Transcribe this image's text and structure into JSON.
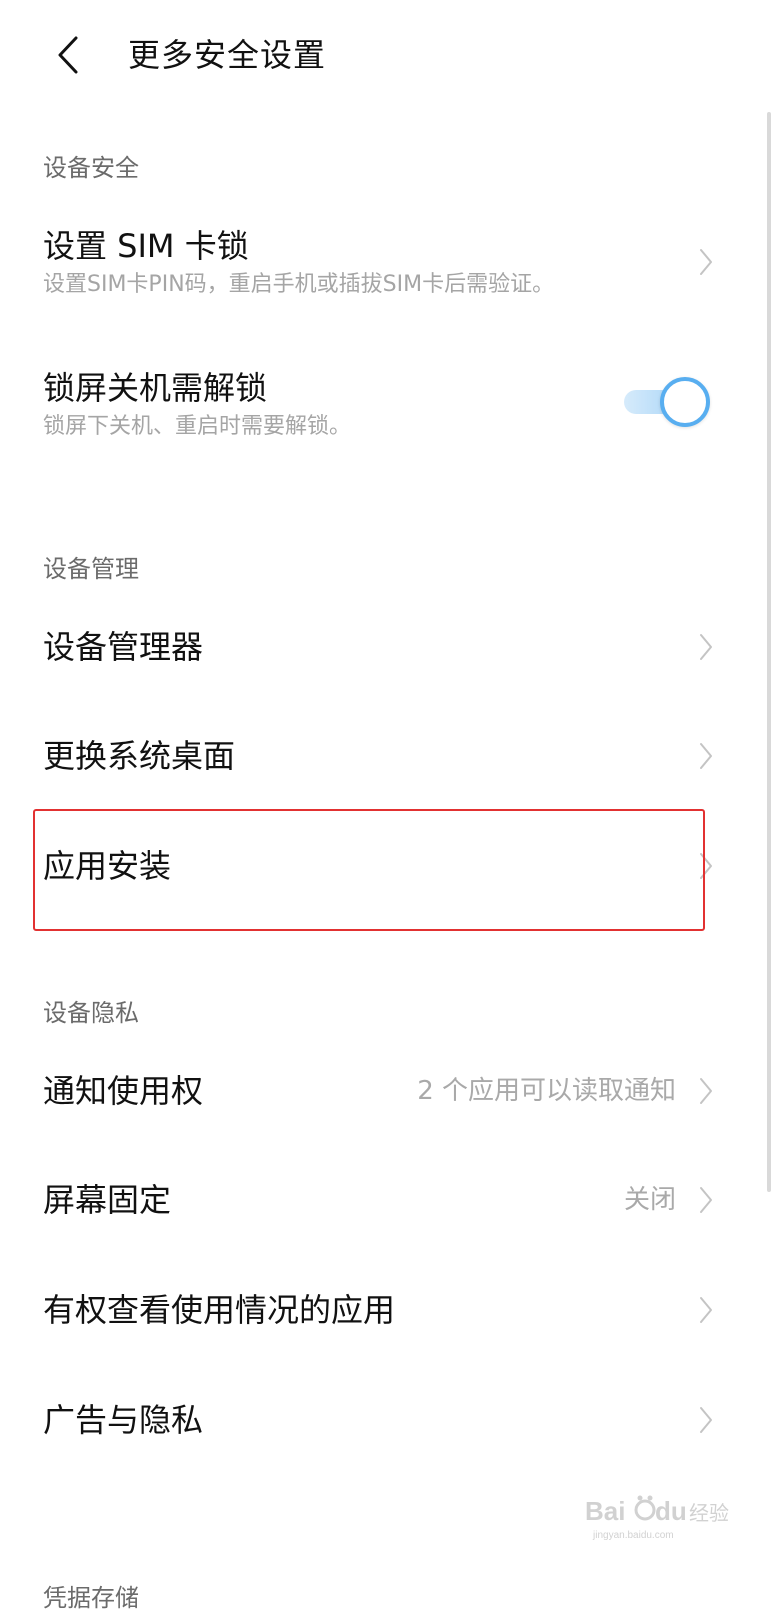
{
  "header": {
    "back_icon": "chevron-left-icon",
    "title": "更多安全设置"
  },
  "sections": {
    "device_security": {
      "header": "设备安全",
      "sim_lock": {
        "title": "设置 SIM 卡锁",
        "subtitle": "设置SIM卡PIN码，重启手机或插拔SIM卡后需验证。"
      },
      "lock_shutdown": {
        "title": "锁屏关机需解锁",
        "subtitle": "锁屏下关机、重启时需要解锁。",
        "toggle_on": true
      }
    },
    "device_management": {
      "header": "设备管理",
      "device_admin": {
        "title": "设备管理器"
      },
      "change_launcher": {
        "title": "更换系统桌面"
      },
      "app_install": {
        "title": "应用安装"
      }
    },
    "device_privacy": {
      "header": "设备隐私",
      "notification_access": {
        "title": "通知使用权",
        "value": "2 个应用可以读取通知"
      },
      "screen_pinning": {
        "title": "屏幕固定",
        "value": "关闭"
      },
      "usage_access": {
        "title": "有权查看使用情况的应用"
      },
      "ads_privacy": {
        "title": "广告与隐私"
      }
    },
    "credential_storage": {
      "header": "凭据存储"
    }
  },
  "colors": {
    "accent": "#58aef0",
    "highlight": "#e23131",
    "secondary_text": "#a5a5a5"
  },
  "watermark": {
    "brand": "Baidu",
    "brand_cn": "经验",
    "url": "jingyan.baidu.com"
  }
}
